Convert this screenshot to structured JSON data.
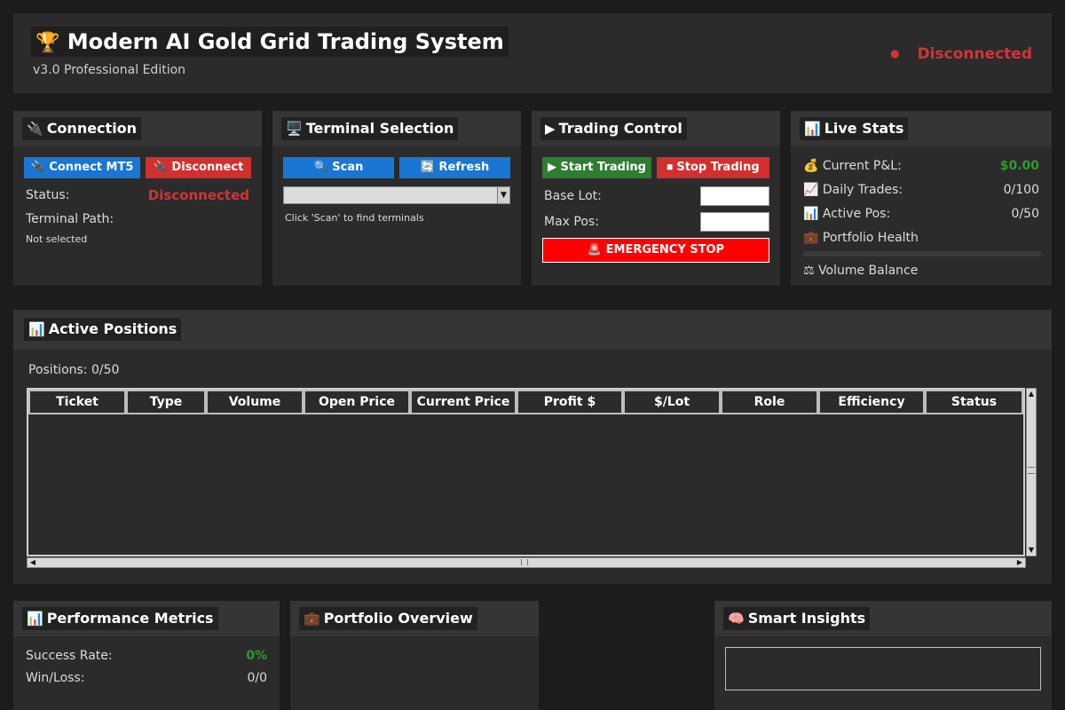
{
  "header": {
    "trophy_icon": "🏆",
    "title": "Modern AI Gold Grid Trading System",
    "subtitle": "v3.0 Professional Edition",
    "status_dot": "●",
    "status": "Disconnected"
  },
  "connection": {
    "icon": "🔌",
    "title": "Connection",
    "connect_label": "🔌 Connect MT5",
    "disconnect_label": "🔌 Disconnect",
    "status_label": "Status:",
    "status_value": "Disconnected",
    "path_label": "Terminal Path:",
    "path_value": "Not selected"
  },
  "terminal": {
    "icon": "🖥️",
    "title": "Terminal Selection",
    "scan_label": "🔍 Scan",
    "refresh_label": "🔄 Refresh",
    "hint": "Click 'Scan' to find terminals"
  },
  "trading": {
    "icon": "▶",
    "title": "Trading Control",
    "start_label": "▶ Start Trading",
    "stop_label": "⏹ Stop Trading",
    "base_lot_label": "Base Lot:",
    "max_pos_label": "Max Pos:",
    "emergency_label": "🚨 EMERGENCY STOP"
  },
  "stats": {
    "icon": "📊",
    "title": "Live Stats",
    "pnl_label": "💰 Current P&L:",
    "pnl_value": "$0.00",
    "trades_label": "📈 Daily Trades:",
    "trades_value": "0/100",
    "active_label": "📊 Active Pos:",
    "active_value": "0/50",
    "health_label": "💼 Portfolio Health",
    "balance_label": "⚖ Volume Balance"
  },
  "positions": {
    "icon": "📊",
    "title": "Active Positions",
    "count_text": "Positions: 0/50",
    "columns": [
      "Ticket",
      "Type",
      "Volume",
      "Open Price",
      "Current Price",
      "Profit $",
      "$/Lot",
      "Role",
      "Efficiency",
      "Status"
    ]
  },
  "performance": {
    "icon": "📊",
    "title": "Performance Metrics",
    "success_label": "Success Rate:",
    "success_value": "0%",
    "winloss_label": "Win/Loss:",
    "winloss_value": "0/0"
  },
  "portfolio": {
    "icon": "💼",
    "title": "Portfolio Overview"
  },
  "insights": {
    "icon": "🧠",
    "title": "Smart Insights"
  },
  "colors": {
    "accent_red": "#d13438",
    "accent_green": "#2e9a2e",
    "button_blue": "#1976d2",
    "emergency_red": "#ff0000"
  }
}
